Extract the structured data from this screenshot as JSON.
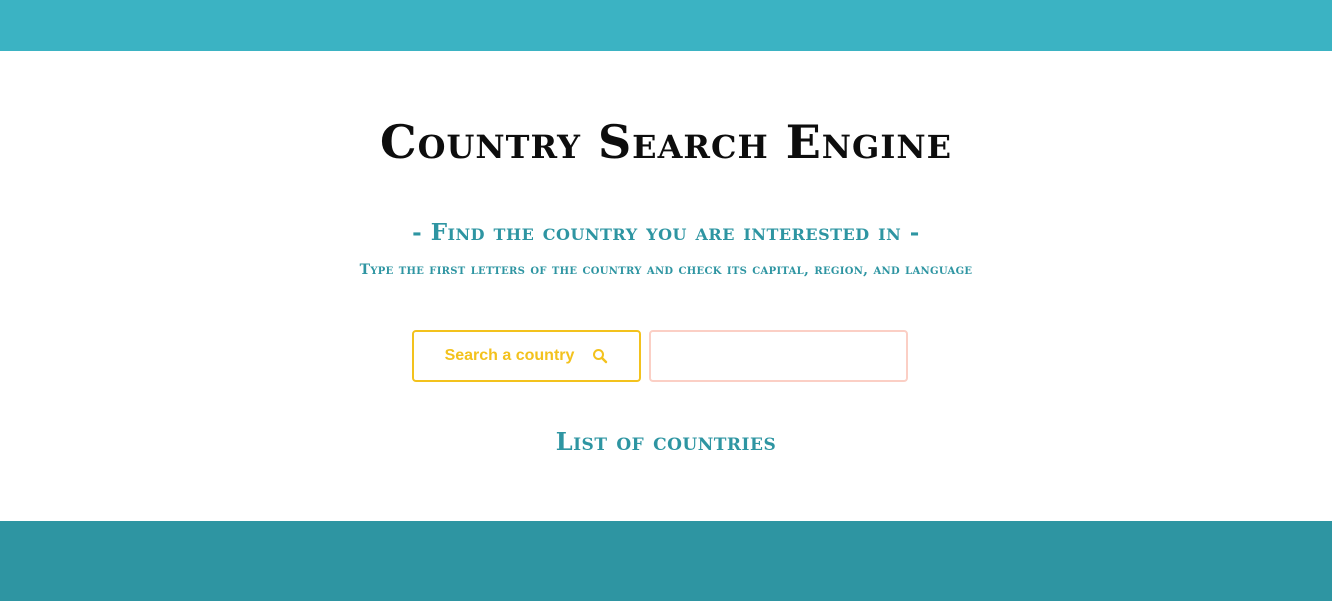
{
  "header": {
    "title": "Country Search Engine",
    "subtitle": "- Find the country you are interested in -",
    "instruction": "Type the first letters of the country and check its capital, region, and language"
  },
  "search": {
    "button_label": "Search a country",
    "button_icon": "search-icon",
    "input_value": "",
    "input_placeholder": ""
  },
  "results": {
    "heading": "List of countries",
    "items": []
  },
  "colors": {
    "top_bar": "#3bb3c3",
    "bottom_bar": "#2e95a2",
    "accent_teal": "#2e95a2",
    "button_yellow": "#f3c21d",
    "input_border": "#fbcfc5"
  }
}
